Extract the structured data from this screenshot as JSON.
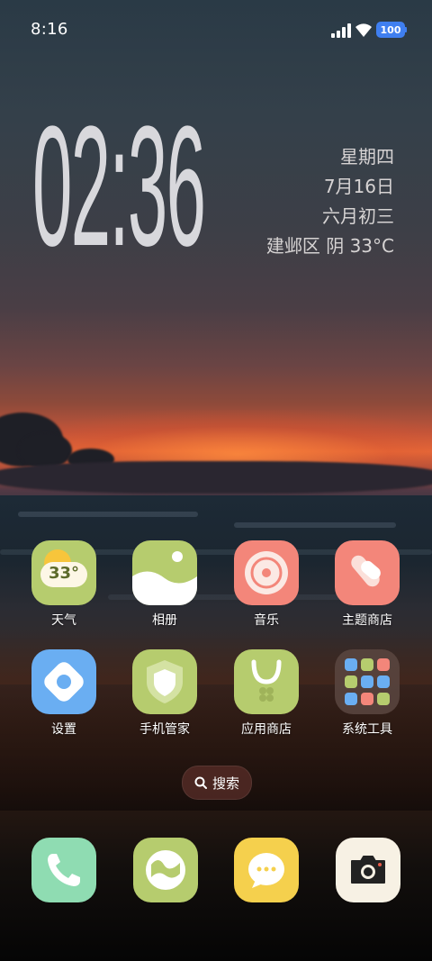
{
  "status_bar": {
    "time": "8:16",
    "battery": "100"
  },
  "clock": {
    "time": "02:36",
    "weekday": "星期四",
    "date": "7月16日",
    "lunar_date": "六月初三",
    "weather_line": "建邺区  阴  33°C"
  },
  "apps": [
    {
      "label": "天气",
      "icon": "weather-icon",
      "badge_text": "33°",
      "color": "#b6cc6e"
    },
    {
      "label": "相册",
      "icon": "gallery-icon",
      "color": "#b6cc6e"
    },
    {
      "label": "音乐",
      "icon": "music-icon",
      "color": "#f3867a"
    },
    {
      "label": "主题商店",
      "icon": "theme-store-icon",
      "color": "#f3867a"
    },
    {
      "label": "设置",
      "icon": "settings-icon",
      "color": "#6aaef2"
    },
    {
      "label": "手机管家",
      "icon": "security-icon",
      "color": "#b6cc6e"
    },
    {
      "label": "应用商店",
      "icon": "app-store-icon",
      "color": "#b6cc6e"
    },
    {
      "label": "系统工具",
      "icon": "folder-icon",
      "color": "#4a3a35"
    }
  ],
  "search": {
    "label": "搜索"
  },
  "dock": [
    {
      "icon": "phone-icon",
      "color": "#8fdcb2"
    },
    {
      "icon": "browser-icon",
      "color": "#b6cc6e"
    },
    {
      "icon": "messages-icon",
      "color": "#f5d04d"
    },
    {
      "icon": "camera-icon",
      "color": "#f7f1e4"
    }
  ]
}
